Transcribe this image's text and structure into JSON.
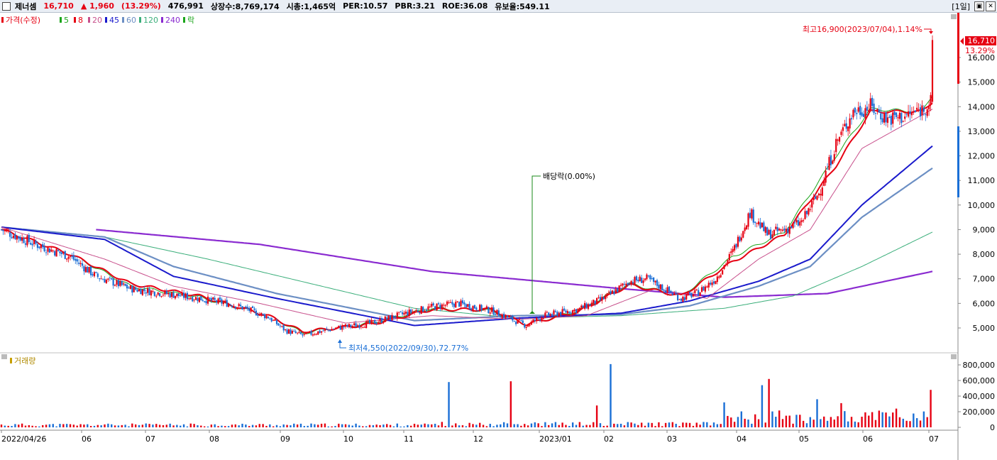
{
  "header": {
    "name": "제너셈",
    "price": "16,710",
    "change": "▲ 1,960",
    "change_pct": "(13.29%)",
    "volume": "476,991",
    "shares": "상장수:8,769,174",
    "mcap": "시총:1,465억",
    "per": "PER:10.57",
    "pbr": "PBR:3.21",
    "roe": "ROE:36.08",
    "float": "유보율:549.11",
    "period": "[1일]"
  },
  "legend": {
    "price": "가격(수정)",
    "ma5": "5",
    "ma8": "8",
    "ma20": "20",
    "ma45": "45",
    "ma60": "60",
    "ma120": "120",
    "ma240": "240",
    "drop": "락",
    "volume": "거래량"
  },
  "annotations": {
    "high": "최고16,900(2023/07/04),1.14%",
    "low": "최저4,550(2022/09/30),72.77%",
    "dividend": "배당락(0.00%)",
    "last_price": "16,710",
    "last_pct": "13.29%"
  },
  "colors": {
    "up": "#e60012",
    "down": "#1a6fd6",
    "ma5": "#1aa51a",
    "ma8": "#e60012",
    "ma20": "#c8508c",
    "ma45": "#1a1acc",
    "ma60": "#6c8fc4",
    "ma120": "#3aae7a",
    "ma240": "#8a2bd0"
  },
  "chart_data": {
    "type": "candlestick",
    "x_ticks": [
      "2022/04/26",
      "06",
      "07",
      "08",
      "09",
      "10",
      "11",
      "12",
      "2023/01",
      "02",
      "03",
      "04",
      "05",
      "06",
      "07"
    ],
    "price_axis": [
      5000,
      6000,
      7000,
      8000,
      9000,
      10000,
      11000,
      12000,
      13000,
      14000,
      15000,
      16000
    ],
    "price_axis_labels": [
      "5,000",
      "6,000",
      "7,000",
      "8,000",
      "9,000",
      "10,000",
      "11,000",
      "12,000",
      "13,000",
      "14,000",
      "15,000",
      "16,000"
    ],
    "volume_axis": [
      0,
      200000,
      400000,
      600000,
      800000
    ],
    "volume_axis_labels": [
      "0",
      "200,000",
      "400,000",
      "600,000",
      "800,000"
    ],
    "price_close_anchors": [
      [
        0,
        9000
      ],
      [
        20,
        8400
      ],
      [
        40,
        7900
      ],
      [
        55,
        7100
      ],
      [
        75,
        6600
      ],
      [
        95,
        6400
      ],
      [
        115,
        6200
      ],
      [
        135,
        5950
      ],
      [
        155,
        5450
      ],
      [
        165,
        4900
      ],
      [
        175,
        4700
      ],
      [
        195,
        5000
      ],
      [
        215,
        5200
      ],
      [
        235,
        5600
      ],
      [
        250,
        5850
      ],
      [
        265,
        6000
      ],
      [
        285,
        5700
      ],
      [
        295,
        5400
      ],
      [
        305,
        5100
      ],
      [
        315,
        5500
      ],
      [
        335,
        5750
      ],
      [
        350,
        6200
      ],
      [
        365,
        6900
      ],
      [
        375,
        7000
      ],
      [
        385,
        6600
      ],
      [
        395,
        6200
      ],
      [
        405,
        6450
      ],
      [
        415,
        7000
      ],
      [
        425,
        8100
      ],
      [
        435,
        9700
      ],
      [
        445,
        8800
      ],
      [
        455,
        9000
      ],
      [
        465,
        9300
      ],
      [
        475,
        10500
      ],
      [
        485,
        12500
      ],
      [
        495,
        13800
      ],
      [
        505,
        14000
      ],
      [
        515,
        13500
      ],
      [
        525,
        13600
      ],
      [
        535,
        13900
      ],
      [
        540,
        14200
      ],
      [
        541,
        16710
      ]
    ],
    "ma5_anchors": [
      [
        0,
        9000
      ],
      [
        40,
        8000
      ],
      [
        75,
        6700
      ],
      [
        115,
        6250
      ],
      [
        155,
        5500
      ],
      [
        175,
        4800
      ],
      [
        215,
        5200
      ],
      [
        250,
        5800
      ],
      [
        285,
        5700
      ],
      [
        305,
        5150
      ],
      [
        335,
        5700
      ],
      [
        365,
        6800
      ],
      [
        395,
        6300
      ],
      [
        425,
        7900
      ],
      [
        455,
        8900
      ],
      [
        485,
        12000
      ],
      [
        505,
        13900
      ],
      [
        535,
        13800
      ],
      [
        541,
        14500
      ]
    ],
    "ma8_anchors": [
      [
        0,
        9000
      ],
      [
        40,
        8000
      ],
      [
        75,
        6800
      ],
      [
        115,
        6300
      ],
      [
        155,
        5500
      ],
      [
        175,
        4850
      ],
      [
        215,
        5150
      ],
      [
        250,
        5750
      ],
      [
        285,
        5750
      ],
      [
        305,
        5150
      ],
      [
        335,
        5650
      ],
      [
        365,
        6750
      ],
      [
        395,
        6300
      ],
      [
        425,
        7700
      ],
      [
        455,
        8800
      ],
      [
        485,
        11600
      ],
      [
        505,
        13800
      ],
      [
        535,
        13800
      ],
      [
        541,
        14200
      ]
    ],
    "ma20_anchors": [
      [
        0,
        9100
      ],
      [
        60,
        7800
      ],
      [
        100,
        6700
      ],
      [
        150,
        6000
      ],
      [
        200,
        5200
      ],
      [
        250,
        5500
      ],
      [
        300,
        5350
      ],
      [
        340,
        5500
      ],
      [
        380,
        6600
      ],
      [
        410,
        6200
      ],
      [
        440,
        7800
      ],
      [
        470,
        9000
      ],
      [
        500,
        12300
      ],
      [
        541,
        13900
      ]
    ],
    "ma45_anchors": [
      [
        0,
        9100
      ],
      [
        60,
        8600
      ],
      [
        100,
        7100
      ],
      [
        160,
        6200
      ],
      [
        240,
        5100
      ],
      [
        300,
        5400
      ],
      [
        360,
        5600
      ],
      [
        400,
        6100
      ],
      [
        440,
        6900
      ],
      [
        470,
        7800
      ],
      [
        500,
        10000
      ],
      [
        541,
        12400
      ]
    ],
    "ma60_anchors": [
      [
        0,
        9100
      ],
      [
        60,
        8700
      ],
      [
        100,
        7500
      ],
      [
        160,
        6400
      ],
      [
        240,
        5300
      ],
      [
        300,
        5500
      ],
      [
        360,
        5550
      ],
      [
        400,
        5900
      ],
      [
        440,
        6700
      ],
      [
        470,
        7500
      ],
      [
        500,
        9500
      ],
      [
        541,
        11500
      ]
    ],
    "ma120_anchors": [
      [
        0,
        9100
      ],
      [
        60,
        8700
      ],
      [
        120,
        7800
      ],
      [
        180,
        6800
      ],
      [
        240,
        5800
      ],
      [
        300,
        5400
      ],
      [
        360,
        5500
      ],
      [
        420,
        5800
      ],
      [
        460,
        6300
      ],
      [
        500,
        7500
      ],
      [
        541,
        8900
      ]
    ],
    "ma240_anchors": [
      [
        55,
        9000
      ],
      [
        150,
        8400
      ],
      [
        250,
        7300
      ],
      [
        360,
        6600
      ],
      [
        420,
        6250
      ],
      [
        480,
        6400
      ],
      [
        541,
        7300
      ]
    ],
    "volume_spikes": [
      [
        260,
        580000
      ],
      [
        296,
        590000
      ],
      [
        346,
        280000
      ],
      [
        354,
        810000
      ],
      [
        420,
        320000
      ],
      [
        443,
        540000
      ],
      [
        446,
        620000
      ],
      [
        475,
        360000
      ],
      [
        488,
        310000
      ],
      [
        520,
        240000
      ],
      [
        541,
        480000
      ]
    ]
  }
}
